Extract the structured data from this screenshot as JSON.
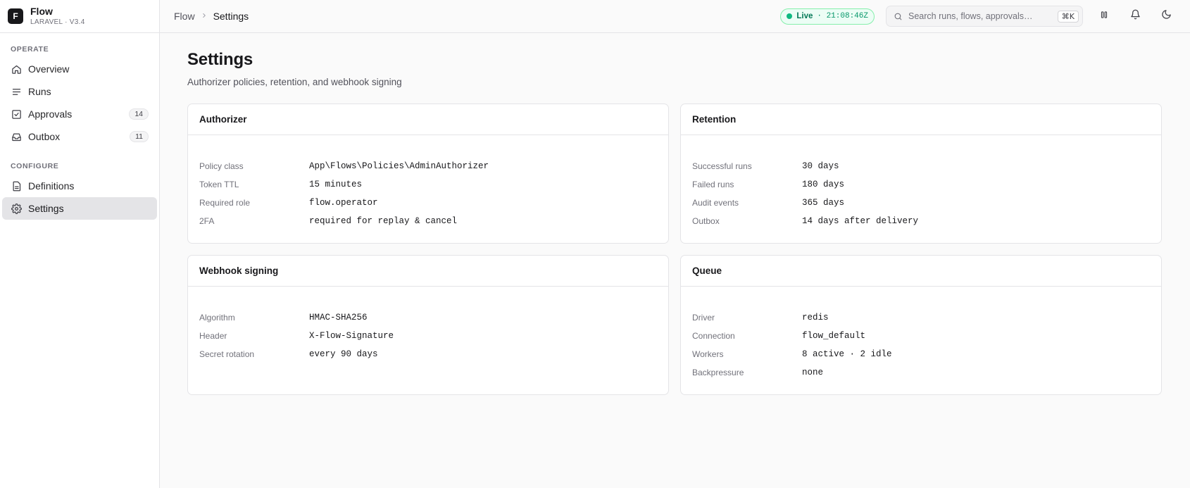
{
  "brand": {
    "logo": "F",
    "name": "Flow",
    "version": "LARAVEL · V3.4"
  },
  "sidebar": {
    "operate_label": "OPERATE",
    "operate_items": [
      {
        "label": "Overview",
        "icon": "home-icon",
        "badge": ""
      },
      {
        "label": "Runs",
        "icon": "list-icon",
        "badge": ""
      },
      {
        "label": "Approvals",
        "icon": "check-square-icon",
        "badge": "14"
      },
      {
        "label": "Outbox",
        "icon": "inbox-icon",
        "badge": "11"
      }
    ],
    "configure_label": "CONFIGURE",
    "configure_items": [
      {
        "label": "Definitions",
        "icon": "file-icon"
      },
      {
        "label": "Settings",
        "icon": "gear-icon",
        "active": true
      }
    ]
  },
  "topbar": {
    "breadcrumb_root": "Flow",
    "breadcrumb_current": "Settings",
    "live_label": "Live",
    "live_time": "· 21:08:46Z",
    "search_placeholder": "Search runs, flows, approvals…",
    "search_shortcut": "⌘K"
  },
  "page": {
    "title": "Settings",
    "subtitle": "Authorizer policies, retention, and webhook signing"
  },
  "cards": {
    "authorizer": {
      "title": "Authorizer",
      "rows": [
        {
          "key": "Policy class",
          "value": "App\\Flows\\Policies\\AdminAuthorizer"
        },
        {
          "key": "Token TTL",
          "value": "15 minutes"
        },
        {
          "key": "Required role",
          "value": "flow.operator"
        },
        {
          "key": "2FA",
          "value": "required for replay & cancel"
        }
      ]
    },
    "retention": {
      "title": "Retention",
      "rows": [
        {
          "key": "Successful runs",
          "value": "30 days"
        },
        {
          "key": "Failed runs",
          "value": "180 days"
        },
        {
          "key": "Audit events",
          "value": "365 days"
        },
        {
          "key": "Outbox",
          "value": "14 days after delivery"
        }
      ]
    },
    "webhook": {
      "title": "Webhook signing",
      "rows": [
        {
          "key": "Algorithm",
          "value": "HMAC-SHA256"
        },
        {
          "key": "Header",
          "value": "X-Flow-Signature"
        },
        {
          "key": "Secret rotation",
          "value": "every 90 days"
        }
      ]
    },
    "queue": {
      "title": "Queue",
      "rows": [
        {
          "key": "Driver",
          "value": "redis"
        },
        {
          "key": "Connection",
          "value": "flow_default"
        },
        {
          "key": "Workers",
          "value": "8 active · 2 idle"
        },
        {
          "key": "Backpressure",
          "value": "none"
        }
      ]
    }
  },
  "colors": {
    "accent_live": "#10b981",
    "sidebar_active_bg": "#e4e4e7",
    "border": "#e4e4e7"
  }
}
